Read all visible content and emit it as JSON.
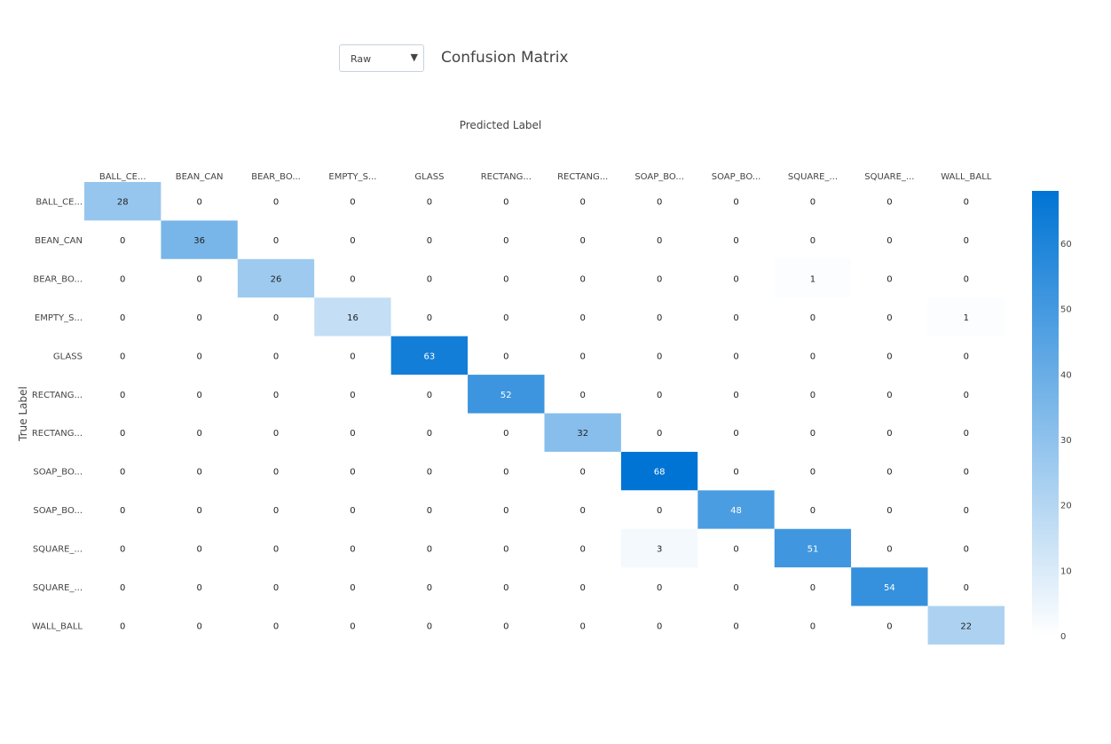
{
  "controls": {
    "normalization_dropdown": {
      "selected": "Raw"
    }
  },
  "chart_data": {
    "type": "heatmap",
    "title": "Confusion Matrix",
    "xlabel": "Predicted Label",
    "ylabel": "True Label",
    "x_categories": [
      "BALL_CE...",
      "BEAN_CAN",
      "BEAR_BO...",
      "EMPTY_S...",
      "GLASS",
      "RECTANG...",
      "RECTANG...",
      "SOAP_BO...",
      "SOAP_BO...",
      "SQUARE_...",
      "SQUARE_...",
      "WALL_BALL"
    ],
    "y_categories": [
      "BALL_CE...",
      "BEAN_CAN",
      "BEAR_BO...",
      "EMPTY_S...",
      "GLASS",
      "RECTANG...",
      "RECTANG...",
      "SOAP_BO...",
      "SOAP_BO...",
      "SQUARE_...",
      "SQUARE_...",
      "WALL_BALL"
    ],
    "values": [
      [
        28,
        0,
        0,
        0,
        0,
        0,
        0,
        0,
        0,
        0,
        0,
        0
      ],
      [
        0,
        36,
        0,
        0,
        0,
        0,
        0,
        0,
        0,
        0,
        0,
        0
      ],
      [
        0,
        0,
        26,
        0,
        0,
        0,
        0,
        0,
        0,
        1,
        0,
        0
      ],
      [
        0,
        0,
        0,
        16,
        0,
        0,
        0,
        0,
        0,
        0,
        0,
        1
      ],
      [
        0,
        0,
        0,
        0,
        63,
        0,
        0,
        0,
        0,
        0,
        0,
        0
      ],
      [
        0,
        0,
        0,
        0,
        0,
        52,
        0,
        0,
        0,
        0,
        0,
        0
      ],
      [
        0,
        0,
        0,
        0,
        0,
        0,
        32,
        0,
        0,
        0,
        0,
        0
      ],
      [
        0,
        0,
        0,
        0,
        0,
        0,
        0,
        68,
        0,
        0,
        0,
        0
      ],
      [
        0,
        0,
        0,
        0,
        0,
        0,
        0,
        0,
        48,
        0,
        0,
        0
      ],
      [
        0,
        0,
        0,
        0,
        0,
        0,
        0,
        3,
        0,
        51,
        0,
        0
      ],
      [
        0,
        0,
        0,
        0,
        0,
        0,
        0,
        0,
        0,
        0,
        54,
        0
      ],
      [
        0,
        0,
        0,
        0,
        0,
        0,
        0,
        0,
        0,
        0,
        0,
        22
      ]
    ],
    "colorscale": {
      "min": 0,
      "max": 68,
      "low_color": "#ffffff",
      "high_color": "#0074d4",
      "ticks": [
        0,
        10,
        20,
        30,
        40,
        50,
        60
      ]
    },
    "x_axis_position": "top"
  }
}
